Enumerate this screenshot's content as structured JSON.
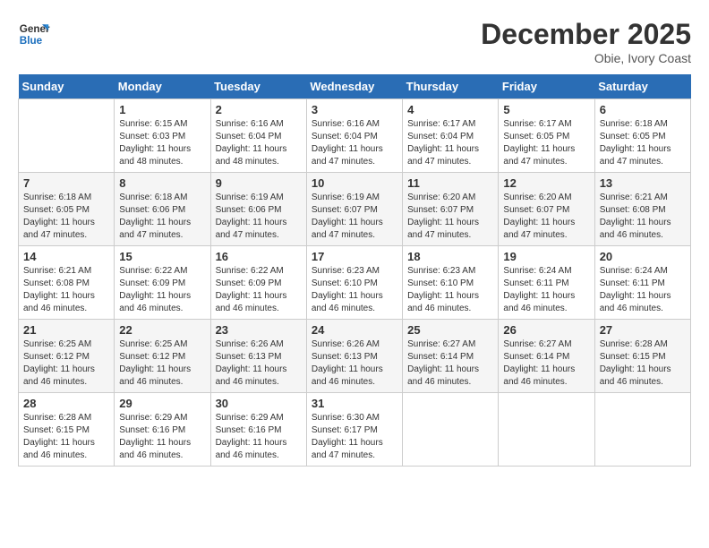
{
  "header": {
    "logo_general": "General",
    "logo_blue": "Blue",
    "month": "December 2025",
    "location": "Obie, Ivory Coast"
  },
  "weekdays": [
    "Sunday",
    "Monday",
    "Tuesday",
    "Wednesday",
    "Thursday",
    "Friday",
    "Saturday"
  ],
  "weeks": [
    [
      {
        "day": "",
        "info": ""
      },
      {
        "day": "1",
        "info": "Sunrise: 6:15 AM\nSunset: 6:03 PM\nDaylight: 11 hours\nand 48 minutes."
      },
      {
        "day": "2",
        "info": "Sunrise: 6:16 AM\nSunset: 6:04 PM\nDaylight: 11 hours\nand 48 minutes."
      },
      {
        "day": "3",
        "info": "Sunrise: 6:16 AM\nSunset: 6:04 PM\nDaylight: 11 hours\nand 47 minutes."
      },
      {
        "day": "4",
        "info": "Sunrise: 6:17 AM\nSunset: 6:04 PM\nDaylight: 11 hours\nand 47 minutes."
      },
      {
        "day": "5",
        "info": "Sunrise: 6:17 AM\nSunset: 6:05 PM\nDaylight: 11 hours\nand 47 minutes."
      },
      {
        "day": "6",
        "info": "Sunrise: 6:18 AM\nSunset: 6:05 PM\nDaylight: 11 hours\nand 47 minutes."
      }
    ],
    [
      {
        "day": "7",
        "info": "Sunrise: 6:18 AM\nSunset: 6:05 PM\nDaylight: 11 hours\nand 47 minutes."
      },
      {
        "day": "8",
        "info": "Sunrise: 6:18 AM\nSunset: 6:06 PM\nDaylight: 11 hours\nand 47 minutes."
      },
      {
        "day": "9",
        "info": "Sunrise: 6:19 AM\nSunset: 6:06 PM\nDaylight: 11 hours\nand 47 minutes."
      },
      {
        "day": "10",
        "info": "Sunrise: 6:19 AM\nSunset: 6:07 PM\nDaylight: 11 hours\nand 47 minutes."
      },
      {
        "day": "11",
        "info": "Sunrise: 6:20 AM\nSunset: 6:07 PM\nDaylight: 11 hours\nand 47 minutes."
      },
      {
        "day": "12",
        "info": "Sunrise: 6:20 AM\nSunset: 6:07 PM\nDaylight: 11 hours\nand 47 minutes."
      },
      {
        "day": "13",
        "info": "Sunrise: 6:21 AM\nSunset: 6:08 PM\nDaylight: 11 hours\nand 46 minutes."
      }
    ],
    [
      {
        "day": "14",
        "info": "Sunrise: 6:21 AM\nSunset: 6:08 PM\nDaylight: 11 hours\nand 46 minutes."
      },
      {
        "day": "15",
        "info": "Sunrise: 6:22 AM\nSunset: 6:09 PM\nDaylight: 11 hours\nand 46 minutes."
      },
      {
        "day": "16",
        "info": "Sunrise: 6:22 AM\nSunset: 6:09 PM\nDaylight: 11 hours\nand 46 minutes."
      },
      {
        "day": "17",
        "info": "Sunrise: 6:23 AM\nSunset: 6:10 PM\nDaylight: 11 hours\nand 46 minutes."
      },
      {
        "day": "18",
        "info": "Sunrise: 6:23 AM\nSunset: 6:10 PM\nDaylight: 11 hours\nand 46 minutes."
      },
      {
        "day": "19",
        "info": "Sunrise: 6:24 AM\nSunset: 6:11 PM\nDaylight: 11 hours\nand 46 minutes."
      },
      {
        "day": "20",
        "info": "Sunrise: 6:24 AM\nSunset: 6:11 PM\nDaylight: 11 hours\nand 46 minutes."
      }
    ],
    [
      {
        "day": "21",
        "info": "Sunrise: 6:25 AM\nSunset: 6:12 PM\nDaylight: 11 hours\nand 46 minutes."
      },
      {
        "day": "22",
        "info": "Sunrise: 6:25 AM\nSunset: 6:12 PM\nDaylight: 11 hours\nand 46 minutes."
      },
      {
        "day": "23",
        "info": "Sunrise: 6:26 AM\nSunset: 6:13 PM\nDaylight: 11 hours\nand 46 minutes."
      },
      {
        "day": "24",
        "info": "Sunrise: 6:26 AM\nSunset: 6:13 PM\nDaylight: 11 hours\nand 46 minutes."
      },
      {
        "day": "25",
        "info": "Sunrise: 6:27 AM\nSunset: 6:14 PM\nDaylight: 11 hours\nand 46 minutes."
      },
      {
        "day": "26",
        "info": "Sunrise: 6:27 AM\nSunset: 6:14 PM\nDaylight: 11 hours\nand 46 minutes."
      },
      {
        "day": "27",
        "info": "Sunrise: 6:28 AM\nSunset: 6:15 PM\nDaylight: 11 hours\nand 46 minutes."
      }
    ],
    [
      {
        "day": "28",
        "info": "Sunrise: 6:28 AM\nSunset: 6:15 PM\nDaylight: 11 hours\nand 46 minutes."
      },
      {
        "day": "29",
        "info": "Sunrise: 6:29 AM\nSunset: 6:16 PM\nDaylight: 11 hours\nand 46 minutes."
      },
      {
        "day": "30",
        "info": "Sunrise: 6:29 AM\nSunset: 6:16 PM\nDaylight: 11 hours\nand 46 minutes."
      },
      {
        "day": "31",
        "info": "Sunrise: 6:30 AM\nSunset: 6:17 PM\nDaylight: 11 hours\nand 47 minutes."
      },
      {
        "day": "",
        "info": ""
      },
      {
        "day": "",
        "info": ""
      },
      {
        "day": "",
        "info": ""
      }
    ]
  ]
}
